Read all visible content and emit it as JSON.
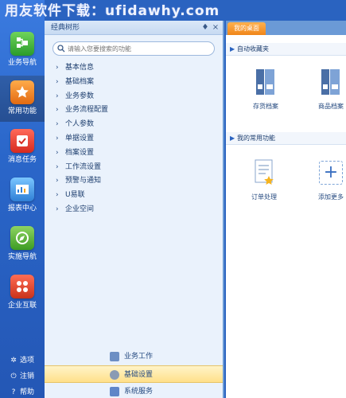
{
  "watermark": "用友软件下载：ufidawhy.com",
  "nav": {
    "items": [
      {
        "label": "业务导航",
        "icon": "business-nav-icon"
      },
      {
        "label": "常用功能",
        "icon": "star-icon"
      },
      {
        "label": "消息任务",
        "icon": "message-task-icon"
      },
      {
        "label": "报表中心",
        "icon": "report-center-icon"
      },
      {
        "label": "实施导航",
        "icon": "compass-icon"
      },
      {
        "label": "企业互联",
        "icon": "enterprise-link-icon"
      }
    ],
    "bottom": [
      {
        "label": "选项",
        "icon": "gear-icon"
      },
      {
        "label": "注销",
        "icon": "logout-icon"
      },
      {
        "label": "帮助",
        "icon": "help-icon"
      }
    ]
  },
  "panel": {
    "title": "经典树形",
    "pin_glyph": "♦",
    "close_glyph": "×",
    "search_placeholder": "请输入您要搜索的功能",
    "tree": [
      "基本信息",
      "基础档案",
      "业务参数",
      "业务流程配置",
      "个人参数",
      "单据设置",
      "档案设置",
      "工作流设置",
      "预警与通知",
      "U易联",
      "企业空间"
    ],
    "bottom": [
      {
        "label": "业务工作",
        "selected": false
      },
      {
        "label": "基础设置",
        "selected": true
      },
      {
        "label": "系统服务",
        "selected": false
      }
    ]
  },
  "desktop": {
    "tab": "我的桌面",
    "favorites_title": "自动收藏夹",
    "favorites": [
      "存货档案",
      "商品档案"
    ],
    "common_title": "我的常用功能",
    "common": [
      "订单处理",
      "添加更多"
    ]
  },
  "colors": {
    "accent": "#2a63c0",
    "tab": "#f08519",
    "selected": "#ffe08a"
  }
}
